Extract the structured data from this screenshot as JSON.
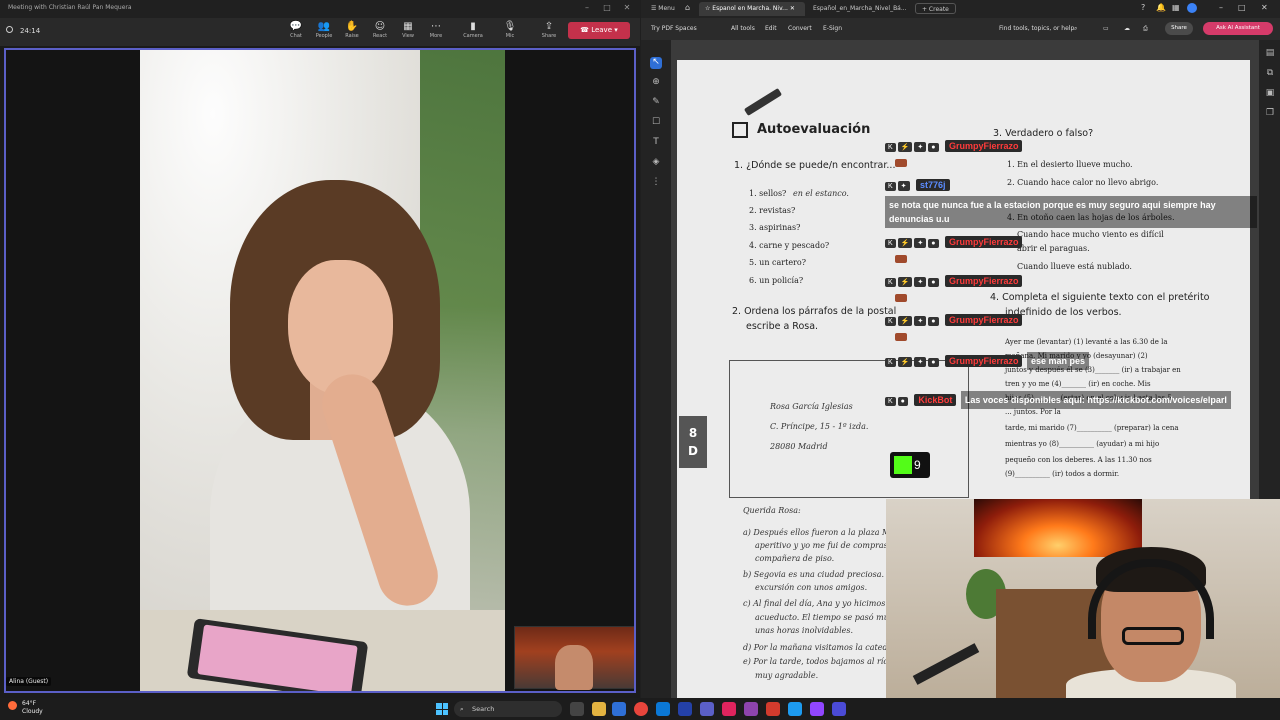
{
  "teams": {
    "window_title": "Meeting with Christian Raúl Pan Mequera",
    "timer": "24:14",
    "toolbar": [
      {
        "label": "Chat",
        "icon": "chat-icon",
        "glyph": "💬"
      },
      {
        "label": "People",
        "icon": "people-icon",
        "glyph": "👥"
      },
      {
        "label": "Raise",
        "icon": "raise-hand-icon",
        "glyph": "✋"
      },
      {
        "label": "React",
        "icon": "react-icon",
        "glyph": "☺"
      },
      {
        "label": "View",
        "icon": "view-icon",
        "glyph": "▦"
      },
      {
        "label": "More",
        "icon": "more-icon",
        "glyph": "⋯"
      },
      {
        "label": "Camera",
        "icon": "camera-icon",
        "glyph": "▮"
      },
      {
        "label": "Mic",
        "icon": "mic-icon",
        "glyph": "🎙"
      },
      {
        "label": "Share",
        "icon": "share-icon",
        "glyph": "⇪"
      }
    ],
    "leave_label": "Leave",
    "participant_name": "Alina (Guest)"
  },
  "pdf": {
    "tabs": [
      {
        "label": "Menu"
      },
      {
        "label": "Espanol en Marcha. Niv..."
      },
      {
        "label": "Español_en_Marcha_Nivel_Bá..."
      },
      {
        "label": "+ Create"
      }
    ],
    "menu": [
      "Try PDF Spaces",
      "All tools",
      "Edit",
      "Convert",
      "E-Sign"
    ],
    "search_placeholder": "Find tools, topics, or help",
    "share_label": "Share",
    "ask_label": "Ask AI Assistant",
    "page": {
      "heading": "Autoevaluación",
      "q1": "1. ¿Dónde se puede/n encontrar...",
      "q1_items": [
        "1. sellos?",
        "2. revistas?",
        "3. aspirinas?",
        "4. carne y pescado?",
        "5. un cartero?",
        "6. un policía?"
      ],
      "q1_answer": "en el estanco.",
      "q2": "2. Ordena los párrafos de la postal",
      "q2b": "escribe a Rosa.",
      "q3": "3. Verdadero o falso?",
      "q3_items": [
        "1. En el desierto llueve mucho.",
        "2. Cuando hace calor no llevo abrigo.",
        "4. En otoño caen las hojas de los árboles.",
        "Cuando hace mucho viento es difícil",
        "abrir el paraguas.",
        "Cuando llueve está nublado."
      ],
      "q4": "4. Completa el siguiente texto con el pretérito",
      "q4b": "indefinido de los verbos.",
      "q4_text": [
        "Ayer me (levantar) (1) levanté a las 6.30 de la",
        "mañana. Mi marido y yo (desayunar) (2)",
        "juntos y después él se (3)_______ (ir) a trabajar en",
        "tren y yo me (4)_______ (ir) en coche. Mis",
        "hijos (5)_______ (estar) en el colegio hasta las 5",
        "... juntos. Por la",
        "tarde, mi marido (7)__________ (preparar) la cena",
        "mientras yo (8)__________ (ayudar) a mi hijo",
        "pequeño con los deberes. A las 11.30 nos",
        "(9)__________ (ir) todos a dormir."
      ],
      "address": [
        "Rosa García Iglesias",
        "C. Príncipe, 15 - 1º izda.",
        "28080 Madrid"
      ],
      "letter": [
        "Querida Rosa:",
        "a) Después ellos fueron a la plaza M...",
        "aperitivo y yo me fui de compras c...",
        "compañera de piso.",
        "b) Segovia es una ciudad preciosa. Ay...",
        "excursión con unos amigos.",
        "c) Al final del día, Ana y yo hicimos...",
        "acueducto. El tiempo se pasó muy r...",
        "unas horas inolvidables.",
        "d) Por la mañana visitamos la catedr...",
        "e) Por la tarde, todos bajamos al río...",
        "muy agradable."
      ],
      "side_tab": [
        "8",
        "D"
      ]
    }
  },
  "chat": {
    "messages": [
      {
        "user": "GrumpyFierrazo",
        "user_color": "#ff3b3b",
        "text": ""
      },
      {
        "user": "st776j",
        "user_color": "#5b8cff",
        "text": "se nota que nunca fue a la estacion porque es muy seguro aqui siempre hay denuncias u.u"
      },
      {
        "user": "GrumpyFierrazo",
        "user_color": "#ff3b3b",
        "text": ""
      },
      {
        "user": "GrumpyFierrazo",
        "user_color": "#ff3b3b",
        "text": ""
      },
      {
        "user": "GrumpyFierrazo",
        "user_color": "#ff3b3b",
        "text": ""
      },
      {
        "user": "GrumpyFierrazo",
        "user_color": "#ff3b3b",
        "text": "ese man pes"
      },
      {
        "user": "KickBot",
        "user_color": "#ff3b3b",
        "text": "Las voces disponibles aquí: https://kickbot.com/voices/elparl"
      }
    ],
    "badges": [
      "K",
      "⚡",
      "✦",
      "●"
    ],
    "points": "9",
    "kick_color": "#53fc18"
  },
  "taskbar": {
    "temp": "64°F",
    "condition": "Cloudy",
    "search_label": "Search"
  },
  "colors": {
    "teams_accent": "#5b5fc7",
    "leave": "#c4314b",
    "ask_ai": "#d63b6a"
  }
}
